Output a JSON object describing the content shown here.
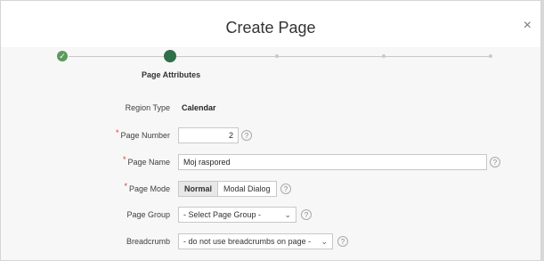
{
  "dialog": {
    "title": "Create Page",
    "close_glyph": "×"
  },
  "wizard": {
    "steps": [
      {
        "state": "done",
        "icon": "check-icon"
      },
      {
        "state": "current",
        "label": "Page Attributes"
      },
      {
        "state": "future"
      },
      {
        "state": "future"
      },
      {
        "state": "future"
      }
    ]
  },
  "form": {
    "required_marker": "*",
    "help_glyph": "?",
    "region_type": {
      "label": "Region Type",
      "value": "Calendar"
    },
    "page_number": {
      "label": "Page Number",
      "value": "2"
    },
    "page_name": {
      "label": "Page Name",
      "value": "Moj raspored"
    },
    "page_mode": {
      "label": "Page Mode",
      "options": [
        "Normal",
        "Modal Dialog"
      ],
      "selected": "Normal"
    },
    "page_group": {
      "label": "Page Group",
      "value": "- Select Page Group -"
    },
    "breadcrumb": {
      "label": "Breadcrumb",
      "value": "- do not use breadcrumbs on page -"
    }
  },
  "colors": {
    "done_step": "#5c9a5c",
    "current_step": "#2f6f4a",
    "required": "#dd3333"
  }
}
